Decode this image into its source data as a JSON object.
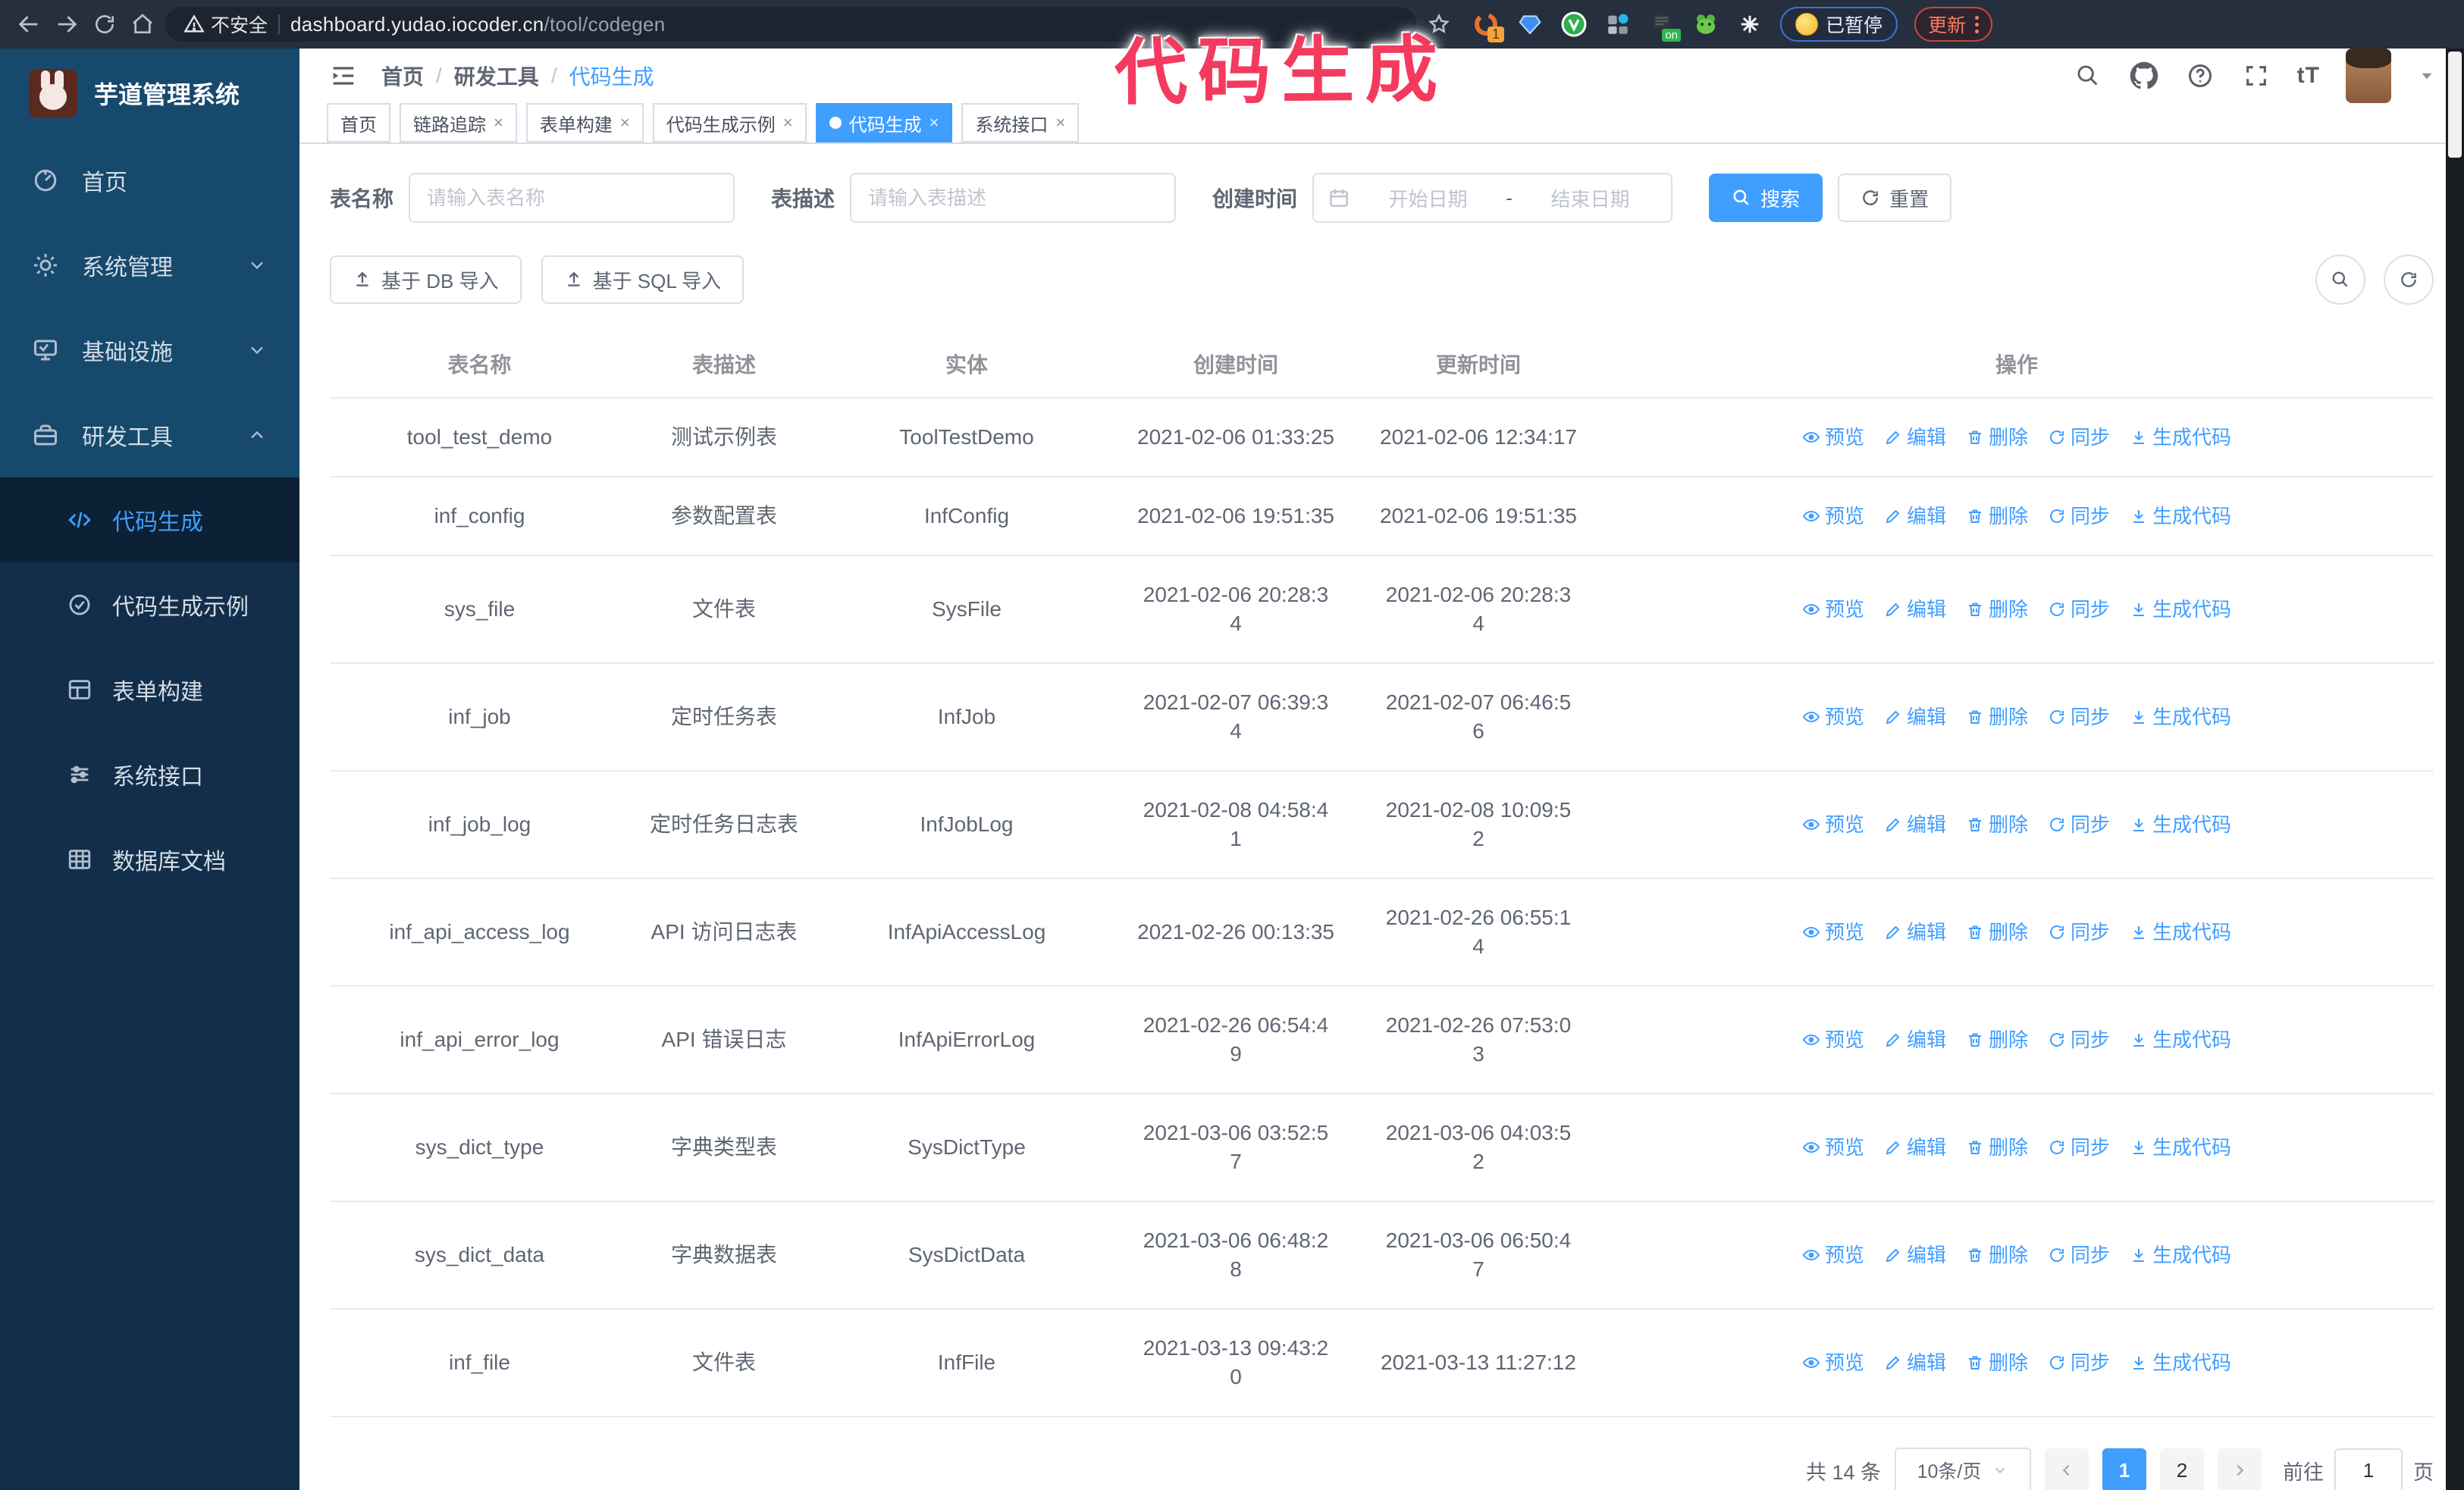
{
  "browser": {
    "security_warning": "不安全",
    "url_host": "dashboard.yudao.iocoder.cn",
    "url_path": "/tool/codegen",
    "ext_badge": "1",
    "ext_on_badge": "on",
    "paused_badge": "已暂停",
    "update_button": "更新"
  },
  "watermark": {
    "text": "代码生成",
    "color": "#f43a5f"
  },
  "sidebar": {
    "title": "芋道管理系统",
    "items": [
      {
        "label": "首页"
      },
      {
        "label": "系统管理"
      },
      {
        "label": "基础设施"
      },
      {
        "label": "研发工具"
      }
    ],
    "submenu": [
      {
        "label": "代码生成"
      },
      {
        "label": "代码生成示例"
      },
      {
        "label": "表单构建"
      },
      {
        "label": "系统接口"
      },
      {
        "label": "数据库文档"
      }
    ]
  },
  "header": {
    "breadcrumb": [
      "首页",
      "研发工具",
      "代码生成"
    ]
  },
  "tabs": [
    {
      "label": "首页"
    },
    {
      "label": "链路追踪"
    },
    {
      "label": "表单构建"
    },
    {
      "label": "代码生成示例"
    },
    {
      "label": "代码生成"
    },
    {
      "label": "系统接口"
    }
  ],
  "filters": {
    "table_name_label": "表名称",
    "table_name_placeholder": "请输入表名称",
    "table_desc_label": "表描述",
    "table_desc_placeholder": "请输入表描述",
    "create_time_label": "创建时间",
    "date_start_placeholder": "开始日期",
    "date_separator": "-",
    "date_end_placeholder": "结束日期",
    "search_button": "搜索",
    "reset_button": "重置"
  },
  "toolbar": {
    "import_db_button": "基于 DB 导入",
    "import_sql_button": "基于 SQL 导入"
  },
  "table": {
    "columns": [
      "表名称",
      "表描述",
      "实体",
      "创建时间",
      "更新时间",
      "操作"
    ],
    "actions": [
      "预览",
      "编辑",
      "删除",
      "同步",
      "生成代码"
    ],
    "rows": [
      {
        "name": "tool_test_demo",
        "desc": "测试示例表",
        "entity": "ToolTestDemo",
        "created": "2021-02-06 01:33:25",
        "updated": "2021-02-06 12:34:17"
      },
      {
        "name": "inf_config",
        "desc": "参数配置表",
        "entity": "InfConfig",
        "created": "2021-02-06 19:51:35",
        "updated": "2021-02-06 19:51:35"
      },
      {
        "name": "sys_file",
        "desc": "文件表",
        "entity": "SysFile",
        "created": "2021-02-06 20:28:3\n4",
        "updated": "2021-02-06 20:28:3\n4"
      },
      {
        "name": "inf_job",
        "desc": "定时任务表",
        "entity": "InfJob",
        "created": "2021-02-07 06:39:3\n4",
        "updated": "2021-02-07 06:46:5\n6"
      },
      {
        "name": "inf_job_log",
        "desc": "定时任务日志表",
        "entity": "InfJobLog",
        "created": "2021-02-08 04:58:4\n1",
        "updated": "2021-02-08 10:09:5\n2"
      },
      {
        "name": "inf_api_access_log",
        "desc": "API 访问日志表",
        "entity": "InfApiAccessLog",
        "created": "2021-02-26 00:13:35",
        "updated": "2021-02-26 06:55:1\n4"
      },
      {
        "name": "inf_api_error_log",
        "desc": "API 错误日志",
        "entity": "InfApiErrorLog",
        "created": "2021-02-26 06:54:4\n9",
        "updated": "2021-02-26 07:53:0\n3"
      },
      {
        "name": "sys_dict_type",
        "desc": "字典类型表",
        "entity": "SysDictType",
        "created": "2021-03-06 03:52:5\n7",
        "updated": "2021-03-06 04:03:5\n2"
      },
      {
        "name": "sys_dict_data",
        "desc": "字典数据表",
        "entity": "SysDictData",
        "created": "2021-03-06 06:48:2\n8",
        "updated": "2021-03-06 06:50:4\n7"
      },
      {
        "name": "inf_file",
        "desc": "文件表",
        "entity": "InfFile",
        "created": "2021-03-13 09:43:2\n0",
        "updated": "2021-03-13 11:27:12"
      }
    ]
  },
  "pagination": {
    "total": "共 14 条",
    "page_size": "10条/页",
    "page_1": "1",
    "page_2": "2",
    "goto_label": "前往",
    "goto_value": "1",
    "goto_unit": "页"
  },
  "colors": {
    "primary": "#409eff",
    "sidebar_bg": "#17496d",
    "sidebar_submenu_bg": "#122e4a",
    "browser_bar_bg": "#262f3d",
    "watermark": "#f43a5f"
  }
}
